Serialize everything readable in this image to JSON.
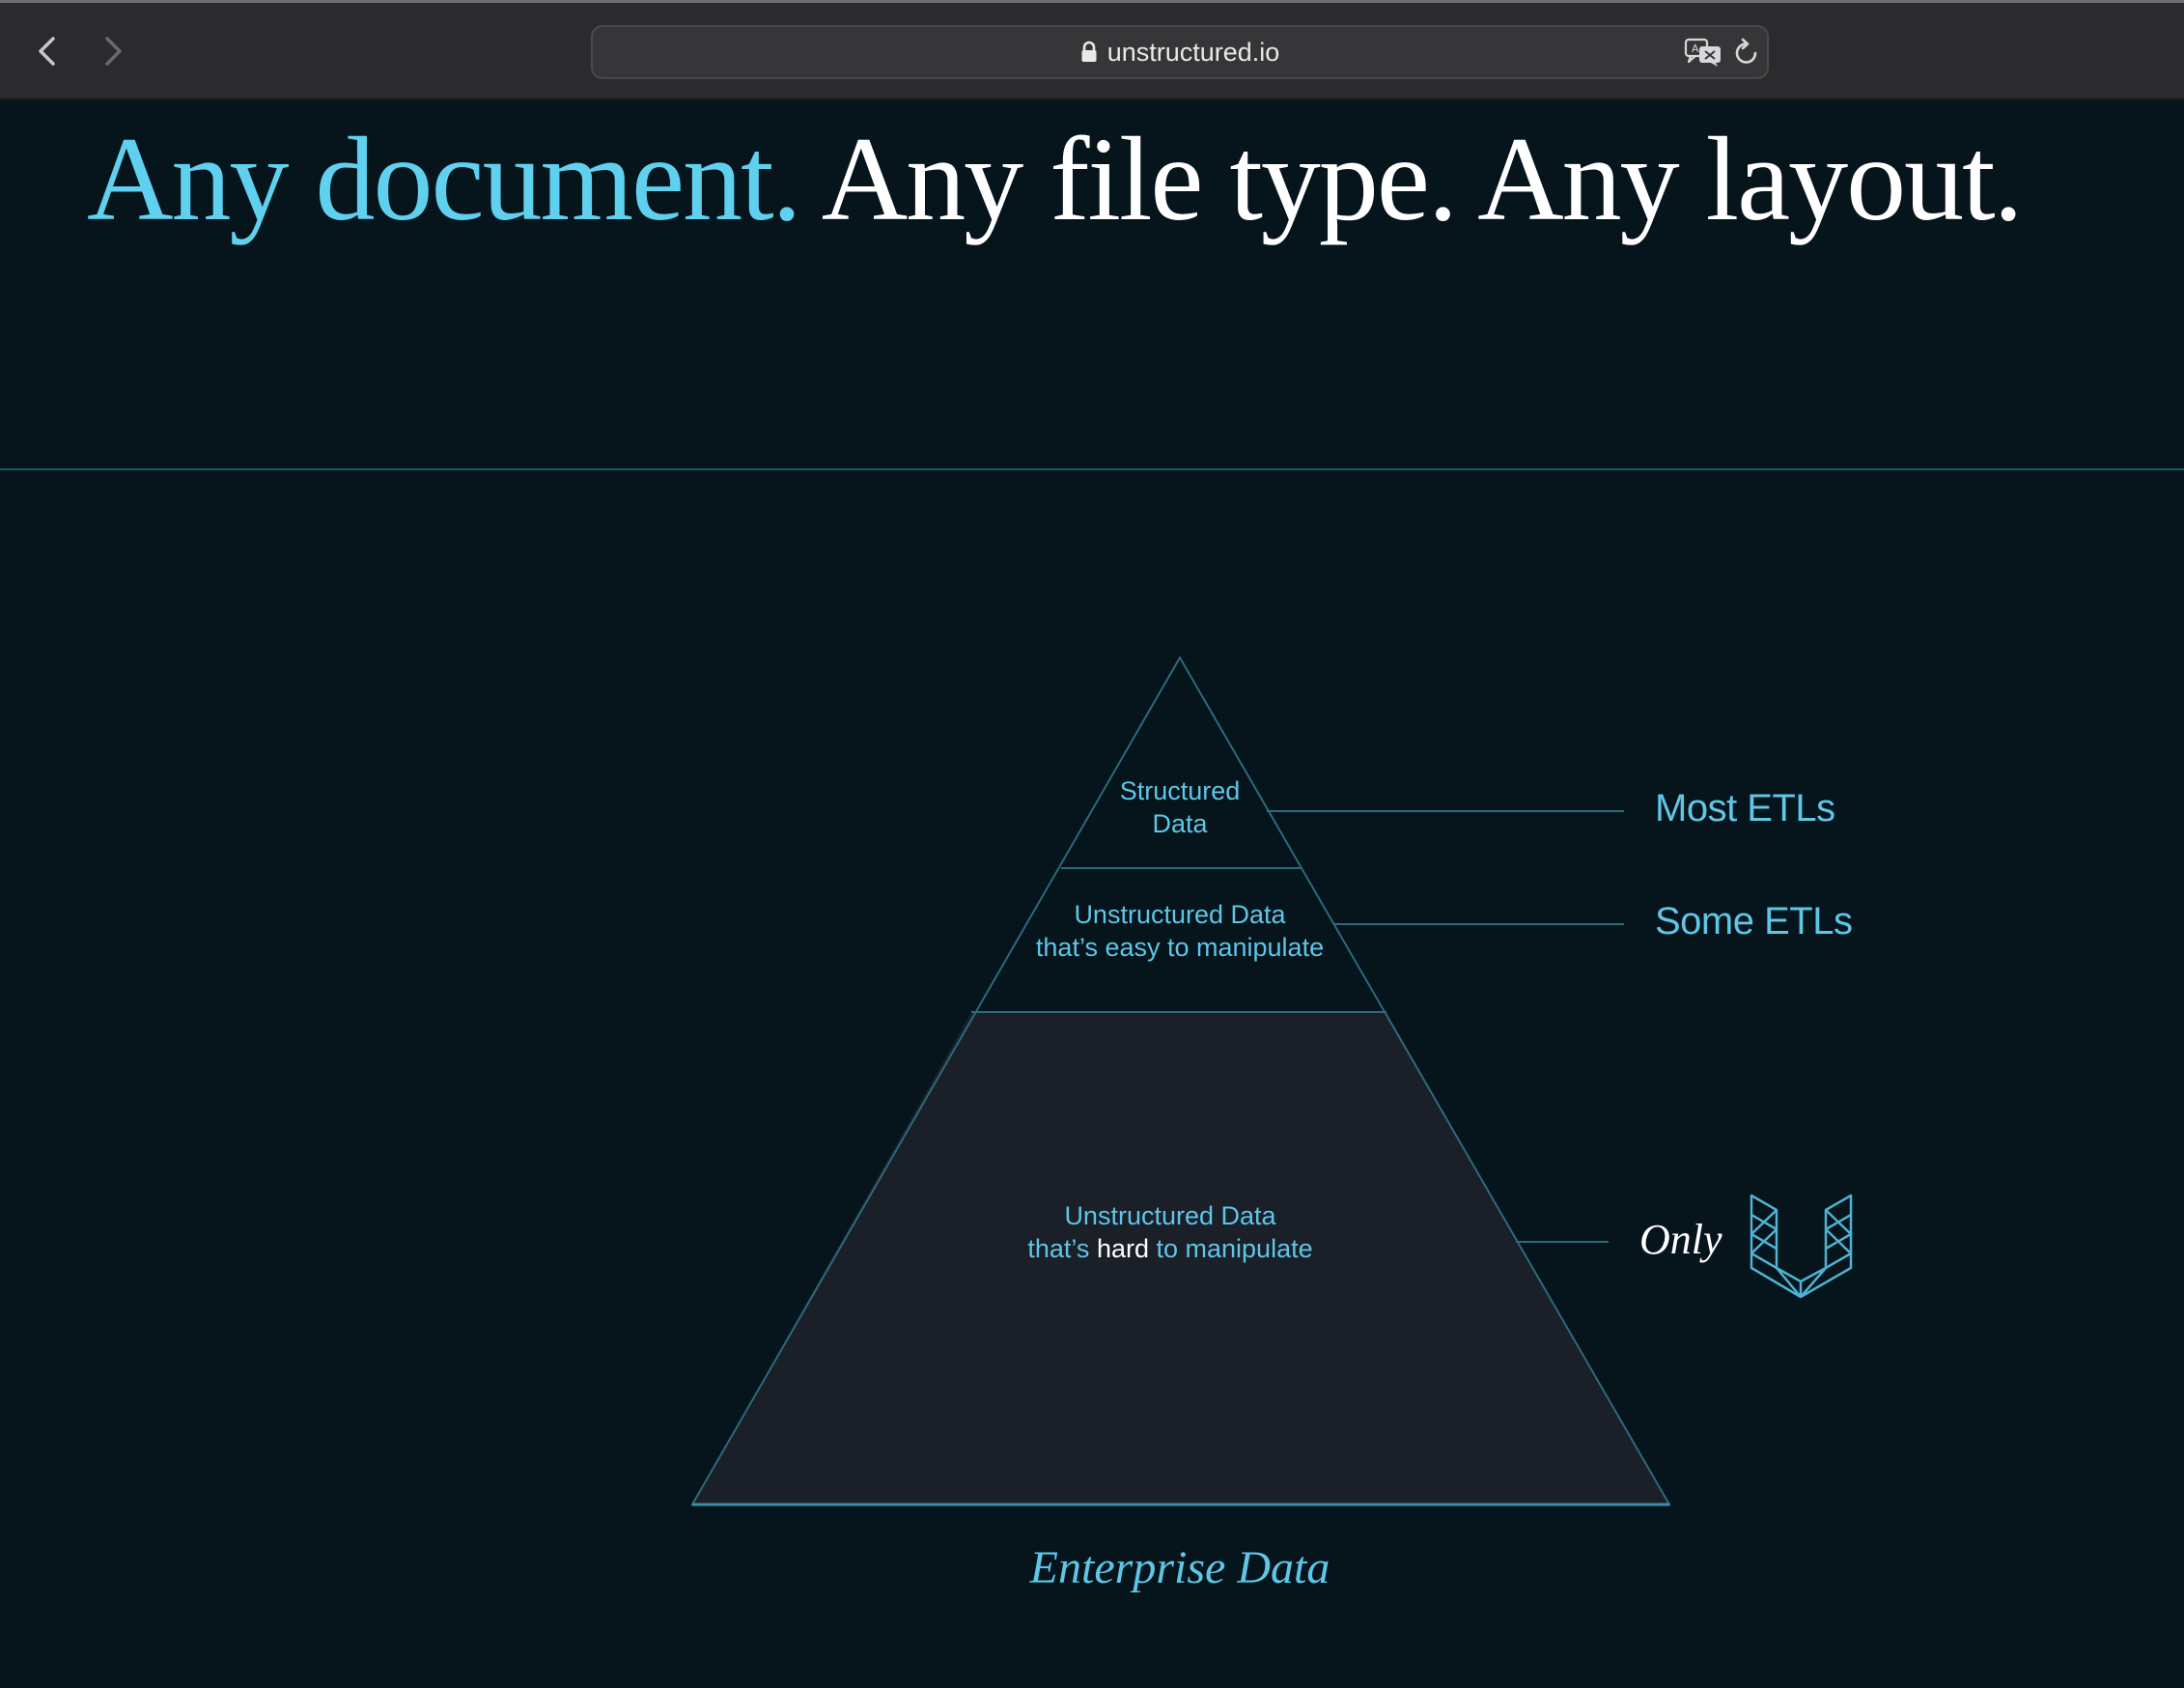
{
  "browser": {
    "url": "unstructured.io",
    "icons": {
      "back": "chevron-left-icon",
      "forward": "chevron-right-icon",
      "lock": "lock-icon",
      "translate": "translate-icon",
      "reload": "reload-icon"
    }
  },
  "hero": {
    "headline_accent": "Any document.",
    "headline_rest": " Any file type. Any layout."
  },
  "pyramid": {
    "tiers": [
      {
        "line1": "Structured",
        "line2": "Data",
        "label": "Most ETLs"
      },
      {
        "line1": "Unstructured Data",
        "line2": "that’s easy to manipulate",
        "label": "Some ETLs"
      },
      {
        "line1": "Unstructured Data",
        "line2_pre": "that’s ",
        "line2_em": "hard",
        "line2_post": " to manipulate",
        "label": "Only"
      }
    ],
    "base_label": "Enterprise Data",
    "logo": "unstructured-logo-icon"
  },
  "colors": {
    "background": "#06141c",
    "accent": "#5fd0ee",
    "pyramid_fill": "#1a1f28",
    "line": "#2c6a7c"
  }
}
